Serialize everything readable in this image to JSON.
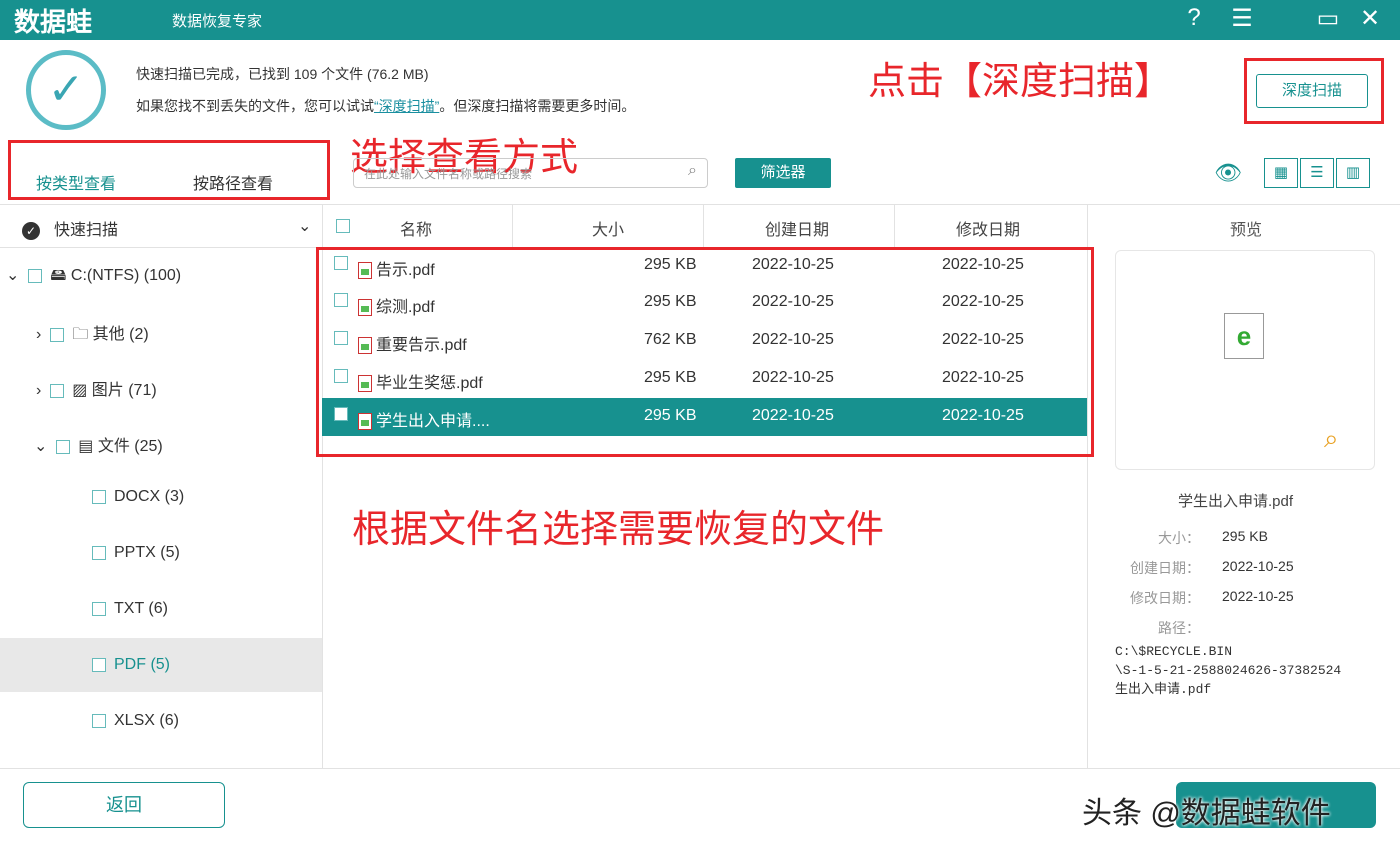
{
  "app": {
    "logo": "数据蛙",
    "subtitle": "数据恢复专家"
  },
  "window": {
    "help": "?",
    "menu": "☰",
    "minimize": "▭",
    "close": "✕"
  },
  "status": {
    "line1": "快速扫描已完成，已找到 109 个文件 (76.2 MB)",
    "line2_prefix": "如果您找不到丢失的文件，您可以试试",
    "line2_link": "“深度扫描”",
    "line2_suffix": "。但深度扫描将需要更多时间。"
  },
  "annotations": {
    "deep": "点击【深度扫描】",
    "view": "选择查看方式",
    "select": "根据文件名选择需要恢复的文件"
  },
  "deep_scan_button": "深度扫描",
  "tabs": [
    "按类型查看",
    "按路径查看"
  ],
  "search": {
    "placeholder": "在此处输入文件名称或路径搜索"
  },
  "filter_button": "筛选器",
  "sidebar": {
    "scan_label": "快速扫描",
    "items": [
      {
        "label": "C:(NTFS) (100)"
      },
      {
        "label": "其他 (2)"
      },
      {
        "label": "图片 (71)"
      },
      {
        "label": "文件 (25)"
      },
      {
        "label": "DOCX (3)"
      },
      {
        "label": "PPTX (5)"
      },
      {
        "label": "TXT (6)"
      },
      {
        "label": "PDF (5)"
      },
      {
        "label": "XLSX (6)"
      }
    ]
  },
  "table": {
    "headers": [
      "名称",
      "大小",
      "创建日期",
      "修改日期"
    ],
    "rows": [
      {
        "name": "告示.pdf",
        "size": "295 KB",
        "created": "2022-10-25",
        "modified": "2022-10-25"
      },
      {
        "name": "综测.pdf",
        "size": "295 KB",
        "created": "2022-10-25",
        "modified": "2022-10-25"
      },
      {
        "name": "重要告示.pdf",
        "size": "762 KB",
        "created": "2022-10-25",
        "modified": "2022-10-25"
      },
      {
        "name": "毕业生奖惩.pdf",
        "size": "295 KB",
        "created": "2022-10-25",
        "modified": "2022-10-25"
      },
      {
        "name": "学生出入申请....",
        "size": "295 KB",
        "created": "2022-10-25",
        "modified": "2022-10-25"
      }
    ]
  },
  "preview": {
    "title": "预览",
    "filename": "学生出入申请.pdf",
    "size_label": "大小：",
    "size": "295 KB",
    "created_label": "创建日期：",
    "created": "2022-10-25",
    "modified_label": "修改日期：",
    "modified": "2022-10-25",
    "path_label": "路径：",
    "path": [
      "C:\\$RECYCLE.BIN",
      "\\S-1-5-21-2588024626-37382524",
      "生出入申请.pdf"
    ]
  },
  "back_button": "返回",
  "watermark": "头条 @数据蛙软件"
}
